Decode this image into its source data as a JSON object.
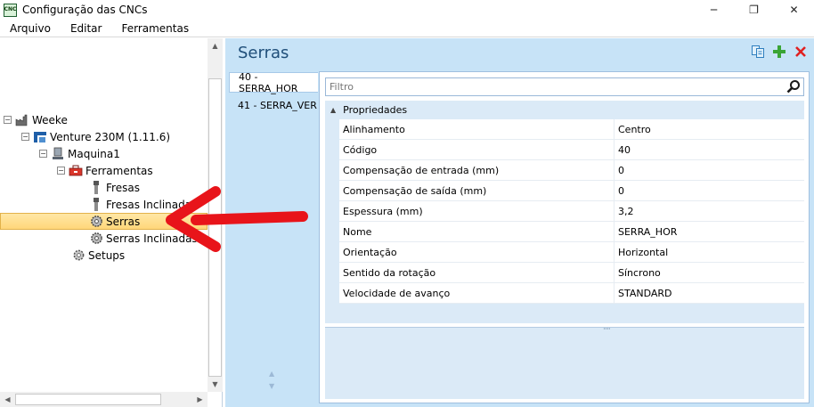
{
  "window": {
    "title": "Configuração das CNCs",
    "app_icon_text": "CNC",
    "minimize_glyph": "─",
    "maximize_glyph": "❐",
    "close_glyph": "✕"
  },
  "menu": [
    "Arquivo",
    "Editar",
    "Ferramentas"
  ],
  "tree": {
    "nodes": [
      {
        "label": "Weeke",
        "expander": "⊟",
        "icon": "factory-icon"
      },
      {
        "label": "Venture 230M (1.11.6)",
        "expander": "⊟",
        "icon": "machine-icon"
      },
      {
        "label": "Maquina1",
        "expander": "⊟",
        "icon": "machine-unit-icon"
      },
      {
        "label": "Ferramentas",
        "expander": "⊟",
        "icon": "toolbox-icon"
      },
      {
        "label": "Fresas",
        "icon": "drill-bit-icon"
      },
      {
        "label": "Fresas Inclinadas",
        "icon": "drill-bit-icon"
      },
      {
        "label": "Serras",
        "icon": "saw-blade-icon",
        "selected": true
      },
      {
        "label": "Serras Inclinadas",
        "icon": "saw-blade-icon"
      },
      {
        "label": "Setups",
        "icon": "gear-icon"
      }
    ]
  },
  "section": {
    "title": "Serras"
  },
  "toolbar": {
    "copy_icon": "copy-icon",
    "add_icon": "add-icon",
    "delete_icon": "delete-icon"
  },
  "tools_list": [
    {
      "label": "40 - SERRA_HOR",
      "active": true
    },
    {
      "label": "41 - SERRA_VER",
      "active": false
    }
  ],
  "filter": {
    "placeholder": "Filtro",
    "value": ""
  },
  "properties": {
    "category": "Propriedades",
    "rows": [
      {
        "name": "Alinhamento",
        "value": "Centro"
      },
      {
        "name": "Código",
        "value": "40"
      },
      {
        "name": "Compensação de entrada (mm)",
        "value": "0"
      },
      {
        "name": "Compensação de saída (mm)",
        "value": "0"
      },
      {
        "name": "Espessura (mm)",
        "value": "3,2"
      },
      {
        "name": "Nome",
        "value": "SERRA_HOR"
      },
      {
        "name": "Orientação",
        "value": "Horizontal"
      },
      {
        "name": "Sentido da rotação",
        "value": "Síncrono"
      },
      {
        "name": "Velocidade de avanço",
        "value": "STANDARD"
      }
    ]
  },
  "colors": {
    "accent": "#1f4e79",
    "selection": "#ffd77a",
    "panel": "#c7e3f7",
    "annotation_arrow": "#e8141a"
  }
}
